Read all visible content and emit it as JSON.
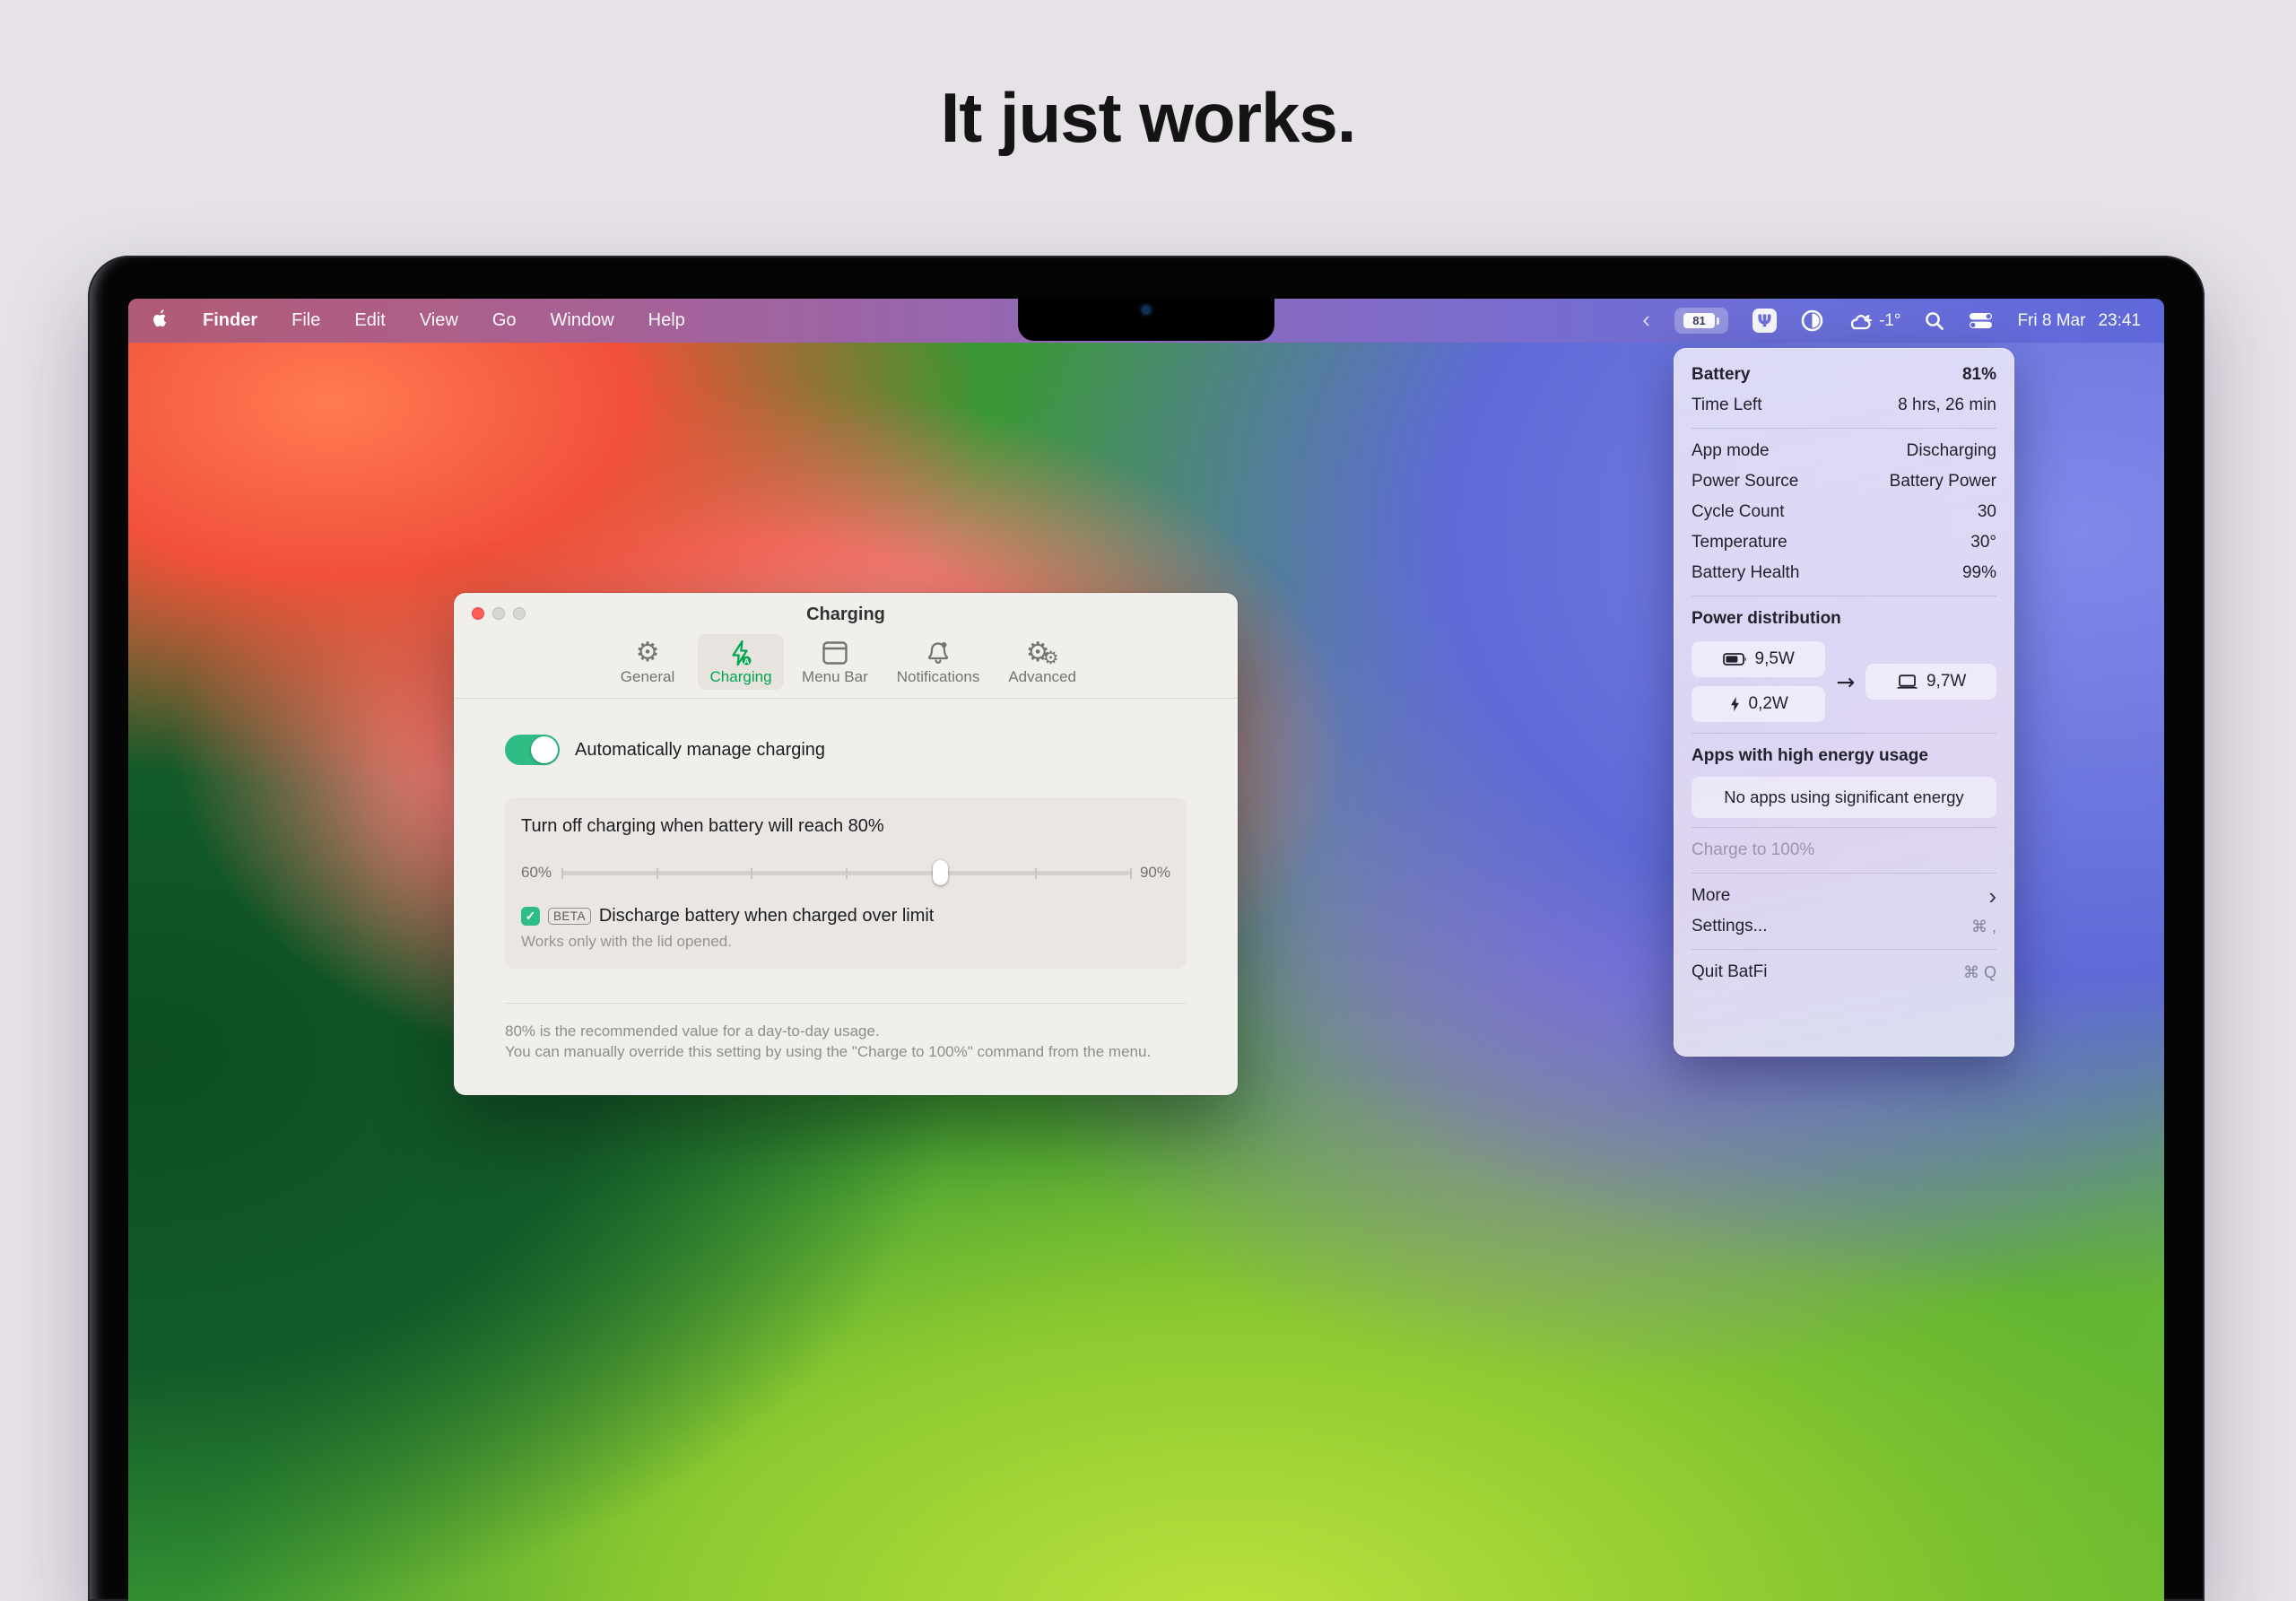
{
  "page": {
    "headline": "It just works."
  },
  "menubar": {
    "items": [
      "Finder",
      "File",
      "Edit",
      "View",
      "Go",
      "Window",
      "Help"
    ],
    "status": {
      "hidden_items_chevron": "‹",
      "battery_percent": "81",
      "temperature": "-1°",
      "date": "Fri 8 Mar",
      "time": "23:41"
    }
  },
  "battery_menu": {
    "header": {
      "label": "Battery",
      "value": "81%"
    },
    "time_left": {
      "label": "Time Left",
      "value": "8 hrs, 26 min"
    },
    "stats": [
      {
        "label": "App mode",
        "value": "Discharging"
      },
      {
        "label": "Power Source",
        "value": "Battery Power"
      },
      {
        "label": "Cycle Count",
        "value": "30"
      },
      {
        "label": "Temperature",
        "value": "30°"
      },
      {
        "label": "Battery Health",
        "value": "99%"
      }
    ],
    "power_distribution": {
      "title": "Power distribution",
      "battery_watts": "9,5W",
      "adapter_watts": "0,2W",
      "arrow": "→",
      "system_watts": "9,7W"
    },
    "apps": {
      "title": "Apps with high energy usage",
      "empty_message": "No apps using significant energy"
    },
    "actions": {
      "charge_to_full": "Charge to 100%",
      "more": "More",
      "more_chevron": "›",
      "settings": "Settings...",
      "settings_shortcut": "⌘ ,",
      "quit": "Quit BatFi",
      "quit_shortcut": "⌘ Q"
    }
  },
  "charging_window": {
    "title": "Charging",
    "tabs": [
      {
        "label": "General"
      },
      {
        "label": "Charging"
      },
      {
        "label": "Menu Bar"
      },
      {
        "label": "Notifications"
      },
      {
        "label": "Advanced"
      }
    ],
    "toggle_label": "Automatically manage charging",
    "limit": {
      "title": "Turn off charging when battery will reach 80%",
      "min": "60%",
      "max": "90%",
      "checkmark": "✓"
    },
    "discharge": {
      "beta": "BETA",
      "label": "Discharge battery when charged over limit",
      "note": "Works only with the lid opened."
    },
    "footer_line1": "80% is the recommended value for a day-to-day usage.",
    "footer_line2": "You can manually override this setting by using the \"Charge to 100%\" command from the menu."
  },
  "colors": {
    "accent_toggle_green": "#2ebd85",
    "tab_selected_green": "#00a64f",
    "menubar_right_blue": "#5f68da",
    "close_button_red": "#ff5e57"
  }
}
